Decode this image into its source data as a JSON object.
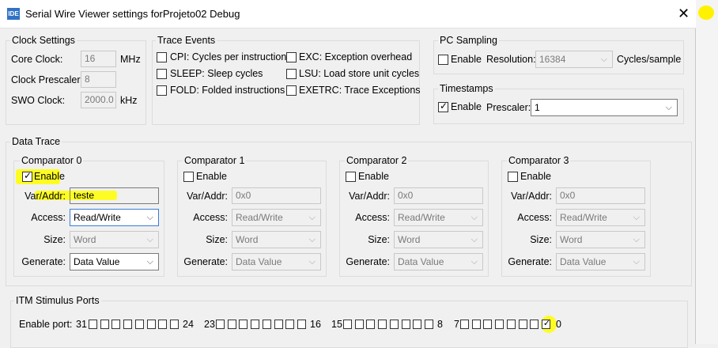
{
  "window": {
    "app_icon": "IDE",
    "title": "Serial Wire Viewer settings forProjeto02 Debug",
    "close_glyph": "✕"
  },
  "clock": {
    "group_label": "Clock Settings",
    "core_label": "Core Clock:",
    "core_value": "16",
    "core_unit": "MHz",
    "prescaler_label": "Clock Prescaler:",
    "prescaler_value": "8",
    "swo_label": "SWO Clock:",
    "swo_value": "2000.0",
    "swo_unit": "kHz"
  },
  "trace_events": {
    "group_label": "Trace Events",
    "items": [
      {
        "label": "CPI: Cycles per instruction",
        "checked": false
      },
      {
        "label": "SLEEP: Sleep cycles",
        "checked": false
      },
      {
        "label": "FOLD: Folded instructions",
        "checked": false
      },
      {
        "label": "EXC: Exception overhead",
        "checked": false
      },
      {
        "label": "LSU: Load store unit cycles",
        "checked": false
      },
      {
        "label": "EXETRC: Trace Exceptions",
        "checked": false
      }
    ]
  },
  "pc_sampling": {
    "group_label": "PC Sampling",
    "enable_label": "Enable",
    "enabled": false,
    "resolution_label": "Resolution:",
    "resolution_value": "16384",
    "unit": "Cycles/sample"
  },
  "timestamps": {
    "group_label": "Timestamps",
    "enable_label": "Enable",
    "enabled": true,
    "prescaler_label": "Prescaler:",
    "prescaler_value": "1"
  },
  "data_trace": {
    "group_label": "Data Trace",
    "labels": {
      "enable": "Enable",
      "var_addr": "Var/Addr:",
      "access": "Access:",
      "size": "Size:",
      "generate": "Generate:"
    },
    "comparators": [
      {
        "title": "Comparator 0",
        "enabled": true,
        "var_addr": "teste",
        "access": "Read/Write",
        "size": "Word",
        "generate": "Data Value"
      },
      {
        "title": "Comparator 1",
        "enabled": false,
        "var_addr": "0x0",
        "access": "Read/Write",
        "size": "Word",
        "generate": "Data Value"
      },
      {
        "title": "Comparator 2",
        "enabled": false,
        "var_addr": "0x0",
        "access": "Read/Write",
        "size": "Word",
        "generate": "Data Value"
      },
      {
        "title": "Comparator 3",
        "enabled": false,
        "var_addr": "0x0",
        "access": "Read/Write",
        "size": "Word",
        "generate": "Data Value"
      }
    ]
  },
  "itm": {
    "group_label": "ITM Stimulus Ports",
    "enable_port_label": "Enable port:",
    "groups": [
      {
        "high": "31",
        "low": "24"
      },
      {
        "high": "23",
        "low": "16"
      },
      {
        "high": "15",
        "low": "8"
      },
      {
        "high": "7",
        "low": "0"
      }
    ],
    "checked_ports": [
      0
    ]
  },
  "colors": {
    "highlight": "#ffff00",
    "accent": "#2f72c6"
  },
  "icons": {
    "chevron": "chevron-down-icon",
    "close": "close-icon",
    "plugin": "plugin-icon"
  }
}
